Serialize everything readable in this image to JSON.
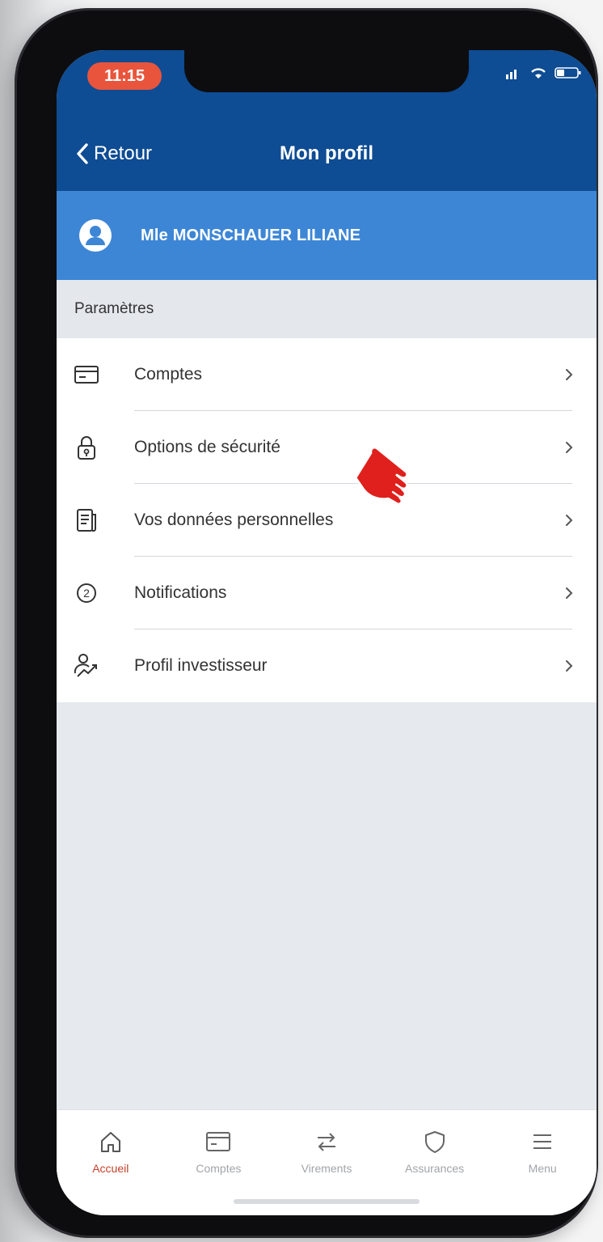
{
  "status": {
    "time": "11:15"
  },
  "nav": {
    "back_label": "Retour",
    "title": "Mon profil"
  },
  "profile": {
    "name": "Mle MONSCHAUER LILIANE"
  },
  "section": {
    "title": "Paramètres"
  },
  "menu": {
    "items": [
      {
        "label": "Comptes",
        "icon": "card-icon"
      },
      {
        "label": "Options de sécurité",
        "icon": "lock-icon"
      },
      {
        "label": "Vos données personnelles",
        "icon": "document-icon"
      },
      {
        "label": "Notifications",
        "icon": "notification-count-icon",
        "badge": "2"
      },
      {
        "label": "Profil investisseur",
        "icon": "investor-profile-icon"
      }
    ]
  },
  "tabbar": {
    "items": [
      {
        "label": "Accueil",
        "icon": "home-icon",
        "active": true
      },
      {
        "label": "Comptes",
        "icon": "card-icon"
      },
      {
        "label": "Virements",
        "icon": "transfer-icon"
      },
      {
        "label": "Assurances",
        "icon": "shield-icon"
      },
      {
        "label": "Menu",
        "icon": "menu-icon"
      }
    ]
  },
  "colors": {
    "primary": "#0e4c93",
    "banner": "#3d86d6",
    "accent": "#c5402a",
    "time_pill": "#e8553c",
    "cursor_hand": "#e0201c"
  }
}
